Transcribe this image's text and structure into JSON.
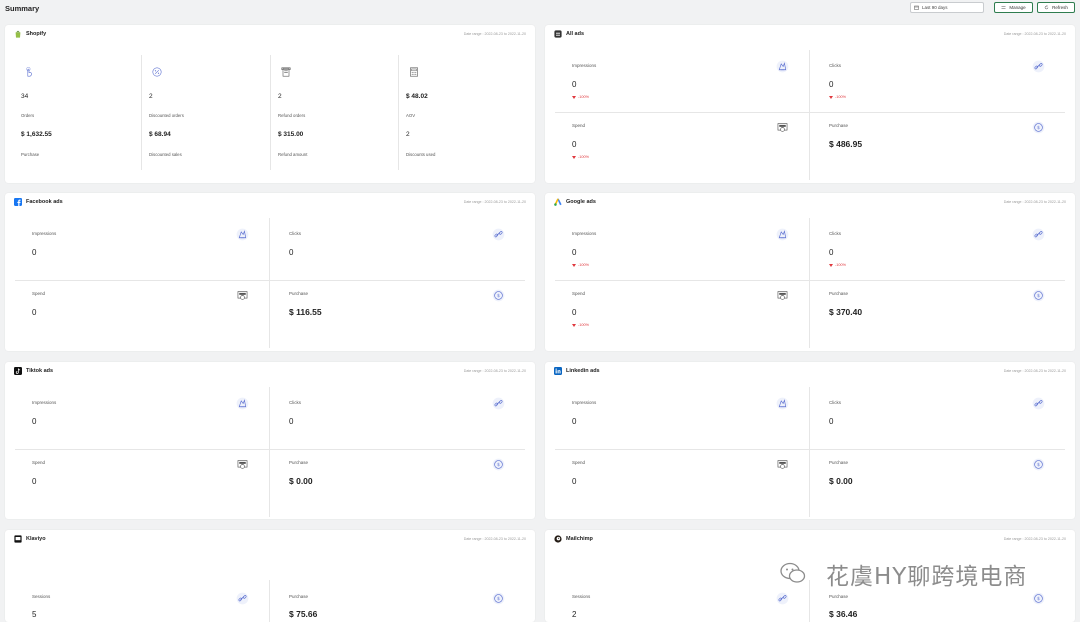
{
  "header": {
    "title": "Summary",
    "date_select": "Last 90 days",
    "manage_label": "Manage",
    "refresh_label": "Refresh"
  },
  "date_range_text": "Date range : 2022-08-23 to 2022-11-20",
  "shopify": {
    "title": "Shopify",
    "cells": [
      {
        "count": "34",
        "count_label": "Orders",
        "money": "$ 1,632.55",
        "money_label": "Purchase",
        "icon": "hand-tap-icon"
      },
      {
        "count": "2",
        "count_label": "Discounted orders",
        "money": "$ 68.94",
        "money_label": "Discounted sales",
        "icon": "percent-icon"
      },
      {
        "count": "2",
        "count_label": "Refund orders",
        "money": "$ 315.00",
        "money_label": "Refund amount",
        "icon": "receipt-icon"
      },
      {
        "count": "$ 48.02",
        "count_label": "AOV",
        "money": "2",
        "money_label": "Discounts used",
        "icon": "calculator-icon"
      }
    ]
  },
  "all_ads": {
    "title": "All ads",
    "impressions": "0",
    "clicks": "0",
    "spend": "0",
    "purchase": "$ 486.95",
    "imp_delta": "-100%",
    "clk_delta": "-100%",
    "spend_delta": "-100%"
  },
  "facebook": {
    "title": "Facebook ads",
    "impressions": "0",
    "clicks": "0",
    "spend": "0",
    "purchase": "$ 116.55"
  },
  "google": {
    "title": "Google ads",
    "impressions": "0",
    "clicks": "0",
    "spend": "0",
    "purchase": "$ 370.40",
    "imp_delta": "-100%",
    "clk_delta": "-100%",
    "spend_delta": "-100%"
  },
  "tiktok": {
    "title": "Tiktok ads",
    "impressions": "0",
    "clicks": "0",
    "spend": "0",
    "purchase": "$ 0.00"
  },
  "linkedin": {
    "title": "Linkedin ads",
    "impressions": "0",
    "clicks": "0",
    "spend": "0",
    "purchase": "$ 0.00"
  },
  "klaviyo": {
    "title": "Klaviyo",
    "sessions": "5",
    "purchase": "$ 75.66"
  },
  "mailchimp": {
    "title": "Mailchimp",
    "sessions": "2",
    "purchase": "$ 36.46"
  },
  "labels": {
    "impressions": "Impressions",
    "clicks": "Clicks",
    "spend": "Spend",
    "purchase": "Purchase",
    "sessions": "Sessions"
  },
  "watermark": "花虞HY聊跨境电商",
  "colors": {
    "accent_green": "#2f7d4f",
    "icon_blue": "#5b6fd0",
    "delta_red": "#e0383e"
  }
}
